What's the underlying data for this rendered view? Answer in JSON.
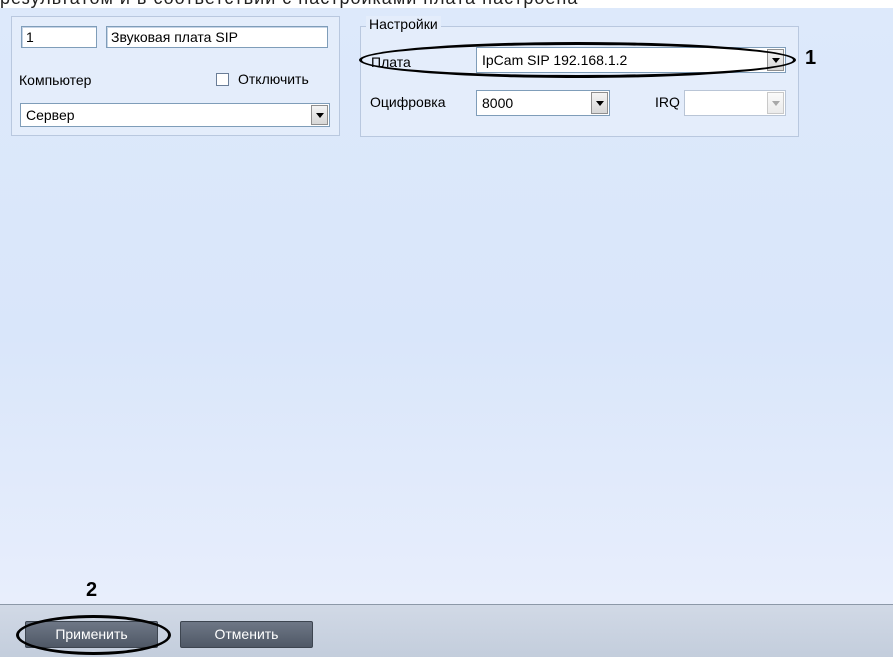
{
  "top_caption": "результатом и в соответствии с настройками плата настроена",
  "general": {
    "id_value": "1",
    "name_value": "Звуковая плата SIP",
    "computer_label": "Компьютер",
    "disable_label": "Отключить",
    "disable_checked": false,
    "computer_value": "Сервер"
  },
  "settings": {
    "group_title": "Настройки",
    "board_label": "Плата",
    "board_value": "IpCam SIP 192.168.1.2",
    "digitization_label": "Оцифровка",
    "digitization_value": "8000",
    "irq_label": "IRQ",
    "irq_value": ""
  },
  "annotations": {
    "marker_1": "1",
    "marker_2": "2"
  },
  "buttons": {
    "apply": "Применить",
    "cancel": "Отменить"
  },
  "icons": {
    "dropdown": "chevron-down-icon"
  }
}
